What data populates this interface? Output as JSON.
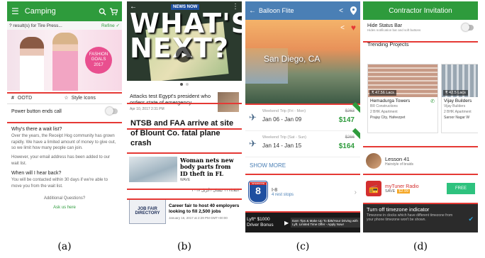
{
  "captions": [
    "(a)",
    "(b)",
    "(c)",
    "(d)"
  ],
  "panel_a": {
    "app_title": "Camping",
    "results_text": "? result(s) for Tire Press...",
    "refine_label": "Refine ✓",
    "banner_text": "FASHION GOALS 2017",
    "tab_ootd": "OOTD",
    "tab_style": "Style Icons",
    "power_label": "Power button ends call",
    "q1": "Why's there a wait list?",
    "a1": "Over the years, the Receipt Hog community has grown rapidly. We have a limited amount of money to give out, so we limit how many people can join.",
    "a1b": "However, your email address has been added to our wait list.",
    "q2": "When will I hear back?",
    "a2": "You will be contacted within 30 days if we're able to move you from the wait list.",
    "additional": "Additional Questions?",
    "ask_link": "Ask us here"
  },
  "panel_b": {
    "logo": "NEWS NOW",
    "hero_text": "WHAT'S NEXT?",
    "story1": "Attacks test Egypt's president who orders state of emergency",
    "story1_date": "Apr 10, 2017 2:31 PM",
    "story2": "NTSB and FAA arrive at site of Blount Co. fatal plane crash",
    "story3": "Woman nets new body parts from ID theft in FL",
    "story3_source": "WAVE",
    "arabic_date": "الثلاثاء ١١ نيسان / أبريل ٢٠١٧",
    "story4": "Career fair to host 40 employers looking to fill 2,500 jobs",
    "story4_date": "January 16, 2017 at 2:29 PM GMT+00:00",
    "job_fair": "JOB FAIR DIRECTORY"
  },
  "panel_c": {
    "app_title": "Balloon Flite",
    "city": "San Diego, CA",
    "trips": [
      {
        "name": "Weekend Trip (Fri - Mon)",
        "dates": "Jan 06 - Jan 09",
        "old_price": "$263",
        "price": "$147"
      },
      {
        "name": "Weekend Trip (Sat - Sun)",
        "dates": "Jan 14 - Jan 15",
        "old_price": "$266",
        "price": "$164"
      }
    ],
    "show_more": "SHOW MORE",
    "interstate": "INTERSTATE",
    "route_number": "8",
    "route_name": "I-8",
    "rest_stops": "4 rest stops",
    "ad_left": "Lyft* $1000 Driver Bonus",
    "ad_right": "Earn Tips & Make Up To $35/Hour Driving with Lyft. Limited Time Offer - Apply Now!"
  },
  "panel_d": {
    "app_title": "Contractor Invitation",
    "hide_status": "Hide Status Bar",
    "hide_status_sub": "Hides notification bar and soft buttons",
    "trending": "Trending Projects",
    "projects": [
      {
        "price": "₹ 47.56 Lacs",
        "name": "Hemadurga Towers",
        "builder": "BR Constructions",
        "type": "2 BHK Apartment",
        "location": "Prajay City, Hafeezpet"
      },
      {
        "price": "₹ 42.5 Lacs",
        "name": "Vijay Builders",
        "builder": "Vijay Builders",
        "type": "2 BHK Apartment",
        "location": "Saroor Nagar W"
      }
    ],
    "lesson_title": "Lesson 41",
    "lesson_sub": "Hairstyle of braids",
    "radio_title": "myTuner Radio",
    "save_label": "SAVE",
    "save_price": "$2.99",
    "free_label": "FREE",
    "tz_title": "Turn off timezone indicator",
    "tz_sub": "Timezone in clocks which have different timezone from your phone timezone won't be shown."
  }
}
